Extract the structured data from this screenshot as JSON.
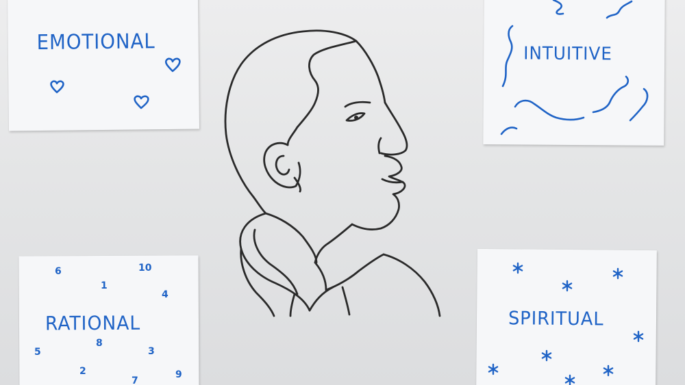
{
  "notes": {
    "emotional": {
      "label": "EMOTIONAL"
    },
    "intuitive": {
      "label": "INTUITIVE"
    },
    "rational": {
      "label": "RATIONAL",
      "numbers": [
        "6",
        "10",
        "1",
        "4",
        "8",
        "5",
        "3",
        "2",
        "7",
        "9"
      ]
    },
    "spiritual": {
      "label": "SPIRITUAL"
    }
  },
  "colors": {
    "ink_blue": "#1f63c6",
    "ink_black": "#2a2a2a",
    "paper": "#f6f7f9",
    "wall": "#e6e7e7"
  },
  "icons": {
    "emotional": "heart-icon",
    "intuitive": "wave-squiggle-icon",
    "spiritual": "asterisk-star-icon"
  }
}
